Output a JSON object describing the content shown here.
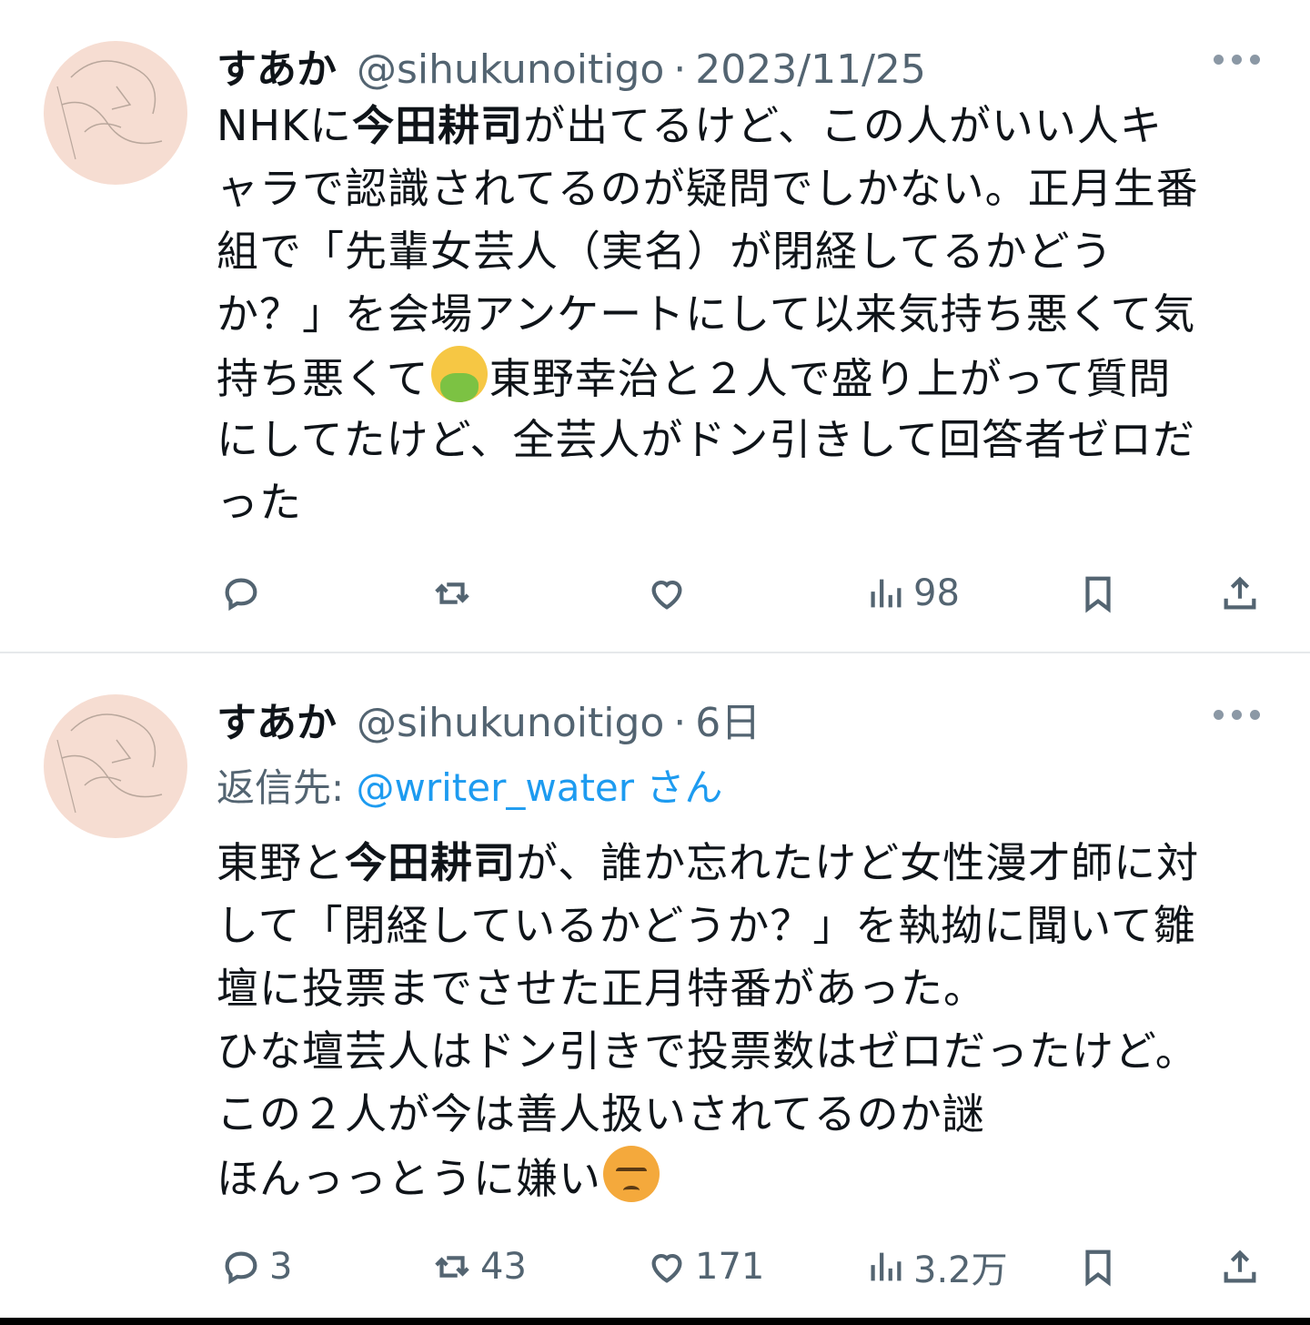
{
  "tweets": [
    {
      "name": "すあか",
      "handle": "@sihukunoitigo",
      "dot": "·",
      "time": "2023/11/25",
      "lines": [
        [
          "NHKに",
          "今田耕司",
          "が出てるけど、この人がいい人キ"
        ],
        [
          "ャラで認識されてるのが疑問でしかない。正月生番"
        ],
        [
          "組で「先輩女芸人（実名）が閉経してるかどう"
        ],
        [
          "か？」を会場アンケートにして以来気持ち悪くて気"
        ],
        [
          "持ち悪くて",
          "東野幸治と２人で盛り上がって質問"
        ],
        [
          "にしてたけど、全芸人がドン引きして回答者ゼロだ"
        ],
        [
          "った"
        ]
      ],
      "emoji": "nauseated-face",
      "counts": {
        "reply": "",
        "retweet": "",
        "like": "",
        "views": "98"
      }
    },
    {
      "name": "すあか",
      "handle": "@sihukunoitigo",
      "dot": "·",
      "time": "6日",
      "replying_label": "返信先: ",
      "replying_mention": "@writer_water",
      "replying_suffix": " さん",
      "lines": [
        [
          "東野と",
          "今田耕司",
          "が、誰か忘れたけど女性漫才師に対"
        ],
        [
          "して「閉経しているかどうか？」を執拗に聞いて雛"
        ],
        [
          "壇に投票までさせた正月特番があった。"
        ],
        [
          "ひな壇芸人はドン引きで投票数はゼロだったけど。"
        ],
        [
          "この２人が今は善人扱いされてるのか謎"
        ],
        [
          "ほんっっとうに嫌い"
        ]
      ],
      "emoji": "angry-face",
      "counts": {
        "reply": "3",
        "retweet": "43",
        "like": "171",
        "views": "3.2万"
      }
    }
  ],
  "icons": [
    "reply-icon",
    "retweet-icon",
    "like-icon",
    "views-icon",
    "bookmark-icon",
    "share-icon",
    "more-icon"
  ],
  "colors": {
    "text": "#0f1419",
    "secondary": "#536471",
    "link": "#1d9bf0"
  }
}
